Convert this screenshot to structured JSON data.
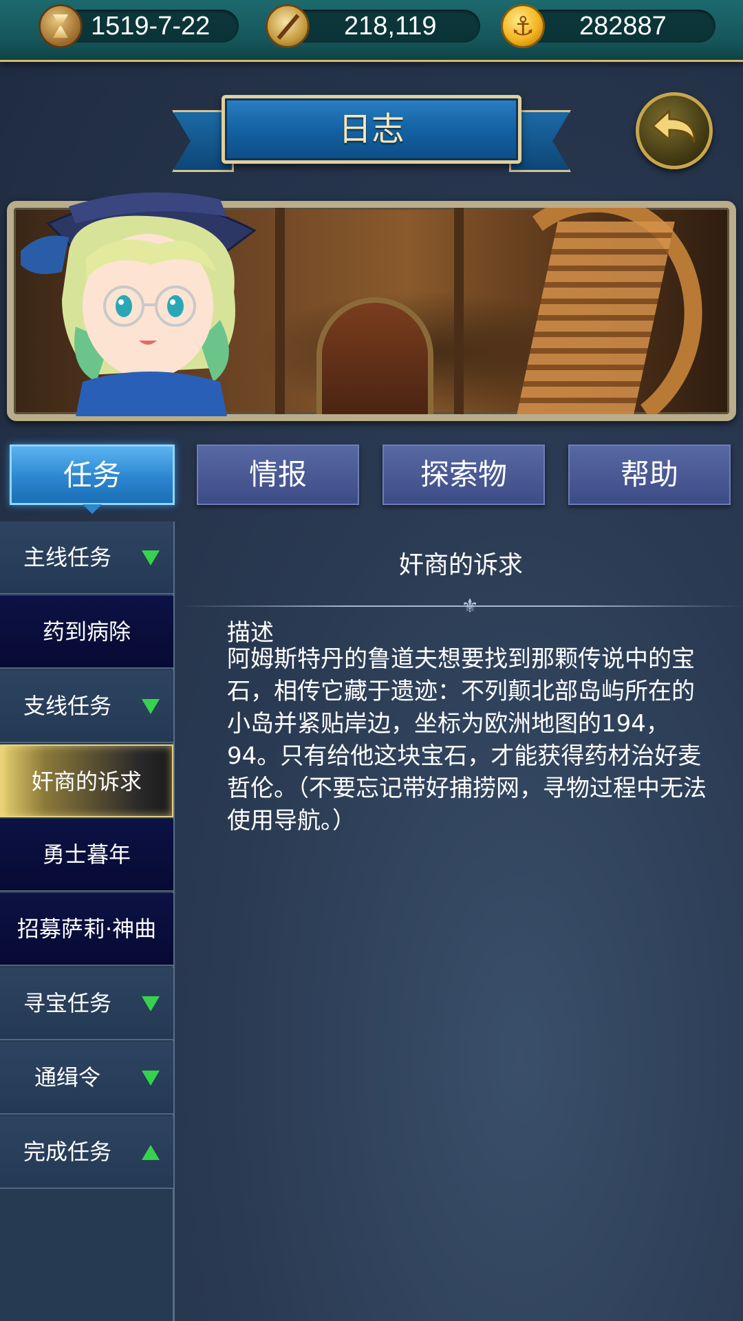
{
  "status_bar": {
    "date": "1519-7-22",
    "exploration_points": "218,119",
    "gold": "282887",
    "icons": [
      "hourglass-icon",
      "compass-icon",
      "anchor-coin-icon"
    ]
  },
  "header": {
    "title": "日志",
    "back_icon": "back-arrow-icon"
  },
  "tabs": [
    {
      "label": "任务",
      "active": true
    },
    {
      "label": "情报",
      "active": false
    },
    {
      "label": "探索物",
      "active": false
    },
    {
      "label": "帮助",
      "active": false
    }
  ],
  "sidebar": {
    "items": [
      {
        "label": "主线任务",
        "type": "header",
        "expanded": true
      },
      {
        "label": "药到病除",
        "type": "sub"
      },
      {
        "label": "支线任务",
        "type": "header",
        "expanded": true
      },
      {
        "label": "奸商的诉求",
        "type": "sub",
        "selected": true
      },
      {
        "label": "勇士暮年",
        "type": "sub"
      },
      {
        "label": "招募萨莉·神曲",
        "type": "sub"
      },
      {
        "label": "寻宝任务",
        "type": "header",
        "expanded": true
      },
      {
        "label": "通缉令",
        "type": "header",
        "expanded": true
      },
      {
        "label": "完成任务",
        "type": "header",
        "expanded": false
      }
    ]
  },
  "quest": {
    "title": "奸商的诉求",
    "description_label": "描述",
    "description": "阿姆斯特丹的鲁道夫想要找到那颗传说中的宝石，相传它藏于遗迹：不列颠北部岛屿所在的小岛并紧贴岸边，坐标为欧洲地图的194，94。只有给他这块宝石，才能获得药材治好麦哲伦。（不要忘记带好捕捞网，寻物过程中无法使用导航。）"
  },
  "colors": {
    "top_bar": "#155559",
    "banner": "#1462a3",
    "active_tab": "#2c86cf",
    "tab": "#3d4c86",
    "expand_arrow": "#36d24e",
    "selected_item": "#e4cf6e"
  }
}
